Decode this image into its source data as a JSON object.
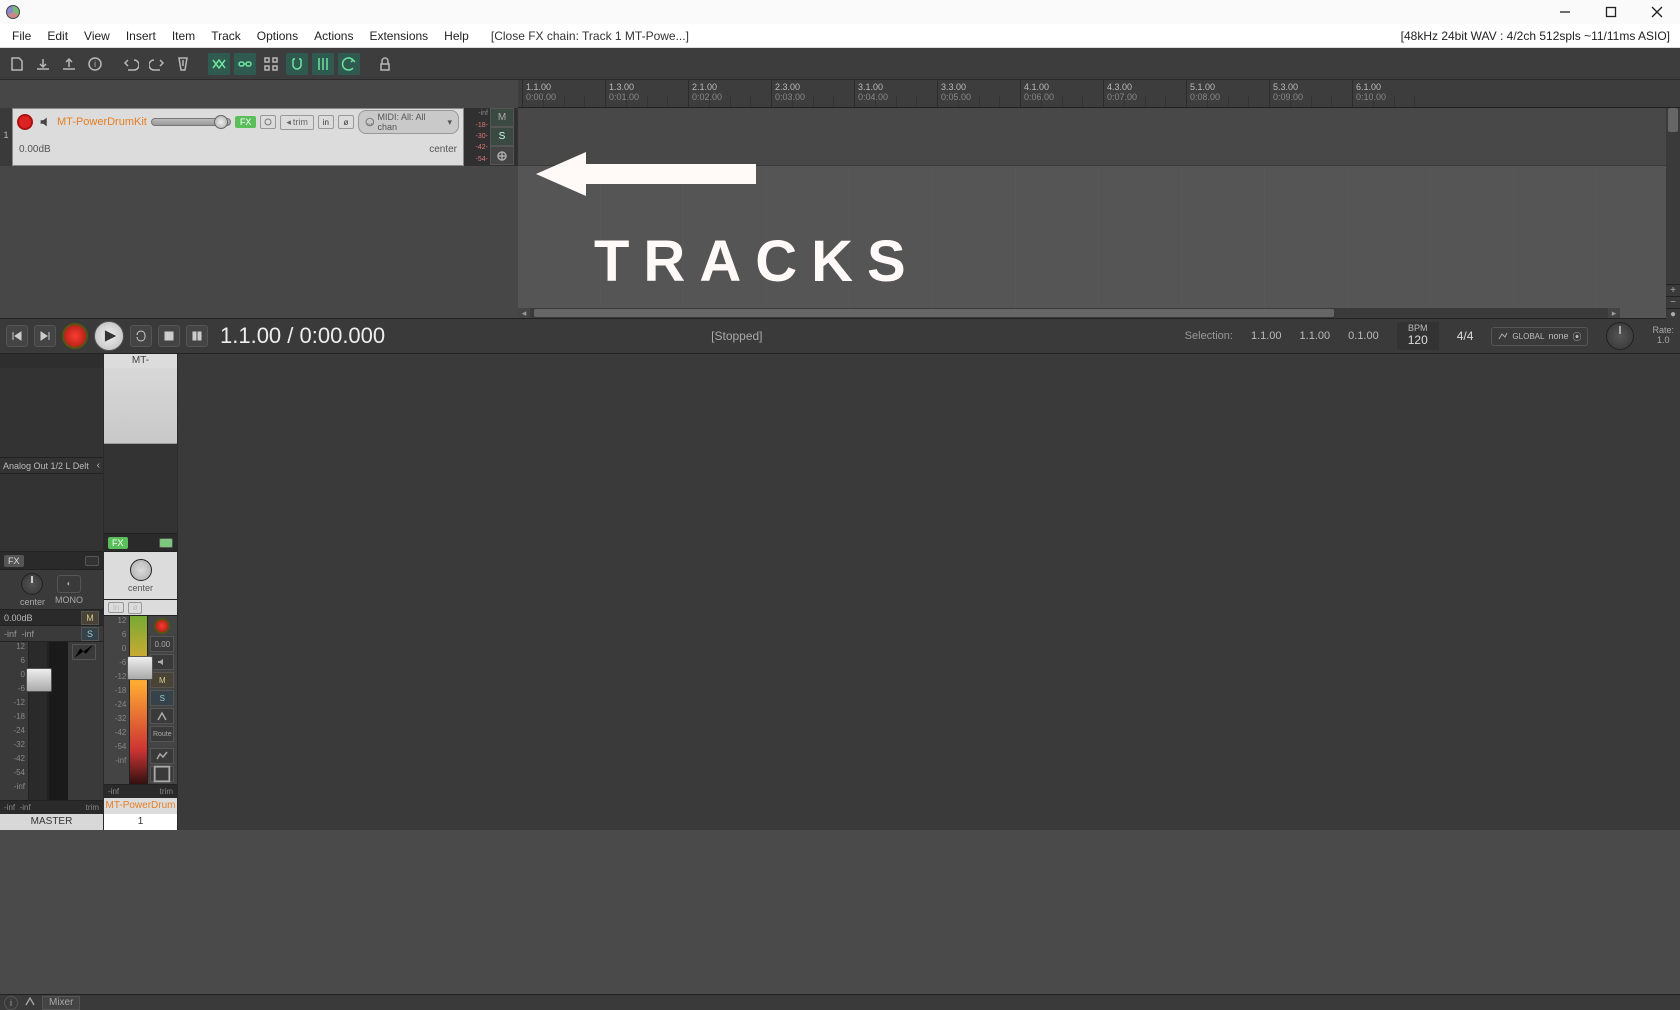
{
  "window": {
    "title_bracket": "[Close FX chain: Track 1 MT-Powe...]"
  },
  "audio_status": "[48kHz 24bit WAV : 4/2ch 512spls ~11/11ms ASIO]",
  "menu": [
    "File",
    "Edit",
    "View",
    "Insert",
    "Item",
    "Track",
    "Options",
    "Actions",
    "Extensions",
    "Help"
  ],
  "ruler_ticks": [
    {
      "bar": "1.1.00",
      "time": "0:00.00"
    },
    {
      "bar": "1.3.00",
      "time": "0:01.00"
    },
    {
      "bar": "2.1.00",
      "time": "0:02.00"
    },
    {
      "bar": "2.3.00",
      "time": "0:03.00"
    },
    {
      "bar": "3.1.00",
      "time": "0:04.00"
    },
    {
      "bar": "3.3.00",
      "time": "0:05.00"
    },
    {
      "bar": "4.1.00",
      "time": "0:06.00"
    },
    {
      "bar": "4.3.00",
      "time": "0:07.00"
    },
    {
      "bar": "5.1.00",
      "time": "0:08.00"
    },
    {
      "bar": "5.3.00",
      "time": "0:09.00"
    },
    {
      "bar": "6.1.00",
      "time": "0:10.00"
    }
  ],
  "track": {
    "num": "1",
    "name": "MT-PowerDrumKit",
    "fx_label": "FX",
    "trim_label": "trim",
    "in_label": "in",
    "midi_in": "MIDI: All: All chan",
    "db": "0.00dB",
    "pan": "center",
    "meter_scale": [
      "-inf",
      "-18-",
      "-30-",
      "-42-",
      "-54-"
    ],
    "m": "M",
    "s": "S"
  },
  "annotation": {
    "text": "TRACKS"
  },
  "transport": {
    "time": "1.1.00 / 0:00.000",
    "status": "[Stopped]",
    "sel_label": "Selection:",
    "sel_start": "1.1.00",
    "sel_end": "1.1.00",
    "sel_len": "0.1.00",
    "bpm_label": "BPM",
    "bpm": "120",
    "timesig": "4/4",
    "env_mode": "none",
    "env_scope": "GLOBAL",
    "rate_label": "Rate:",
    "rate": "1.0"
  },
  "mixer": {
    "master": {
      "hw_out": "Analog Out 1/2 L Delt",
      "fx": "FX",
      "pan": "center",
      "mono": "MONO",
      "db": "0.00dB",
      "m": "M",
      "s": "S",
      "inf_l": "-inf",
      "inf_r": "-inf",
      "trim": "trim",
      "bottom": "MASTER",
      "scale": [
        "12",
        "6",
        "0",
        "-6",
        "-12",
        "-18",
        "-24",
        "-32",
        "-42",
        "-54",
        "-inf"
      ]
    },
    "track1": {
      "name_top": "MT-PowerDrumk",
      "fx": "FX",
      "pan": "center",
      "in": "in",
      "db": "0.00",
      "m": "M",
      "s": "S",
      "route": "Route",
      "inf": "-inf",
      "trim": "trim",
      "bottom_name": "MT-PowerDrum",
      "bottom_num": "1",
      "scale": [
        "12",
        "6",
        "0",
        "-6",
        "-12",
        "-18",
        "-24",
        "-32",
        "-42",
        "-54",
        "-inf"
      ]
    }
  },
  "statusbar": {
    "mixer_tab": "Mixer"
  }
}
